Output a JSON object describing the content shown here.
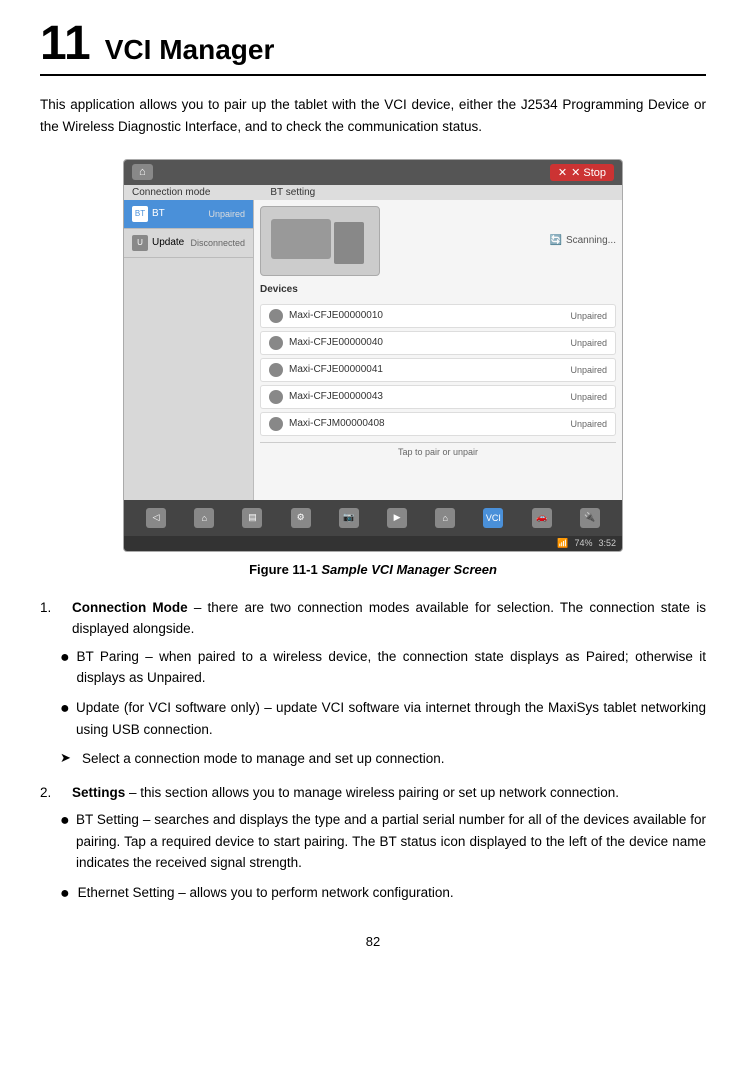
{
  "chapter": {
    "number": "11",
    "title": "VCI Manager"
  },
  "intro": {
    "paragraph": "This application allows you to pair up the tablet with the VCI device, either the J2534 Programming Device or the Wireless Diagnostic Interface, and to check the communication status."
  },
  "screenshot": {
    "top_bar": {
      "home_label": "⌂",
      "stop_label": "✕ Stop"
    },
    "mode_bar": {
      "left": "Connection mode",
      "right": "BT setting"
    },
    "left_panel": {
      "items": [
        {
          "icon": "BT",
          "label": "BT",
          "status": "Unpaired",
          "active": true
        },
        {
          "icon": "U",
          "label": "Update",
          "status": "Disconnected",
          "active": false
        }
      ]
    },
    "right_panel": {
      "device_labels": {
        "left": "Devices",
        "right": "Scanning..."
      },
      "devices": [
        {
          "name": "Maxi-CFJE00000010",
          "status": "Unpaired"
        },
        {
          "name": "Maxi-CFJE00000040",
          "status": "Unpaired"
        },
        {
          "name": "Maxi-CFJE00000041",
          "status": "Unpaired"
        },
        {
          "name": "Maxi-CFJE00000043",
          "status": "Unpaired"
        },
        {
          "name": "Maxi-CFJM00000408",
          "status": "Unpaired"
        }
      ],
      "tap_hint": "Tap to pair or unpair"
    },
    "status_bar": {
      "battery": "74%",
      "time": "3:52"
    }
  },
  "figure": {
    "label": "Figure 11-1",
    "italic_text": "Sample VCI Manager Screen"
  },
  "sections": [
    {
      "num": "1.",
      "term": "Connection Mode",
      "dash": "–",
      "text": " there are two connection modes available for selection. The connection state is displayed alongside.",
      "bullets": [
        {
          "type": "bullet",
          "text": "BT Paring – when paired to a wireless device, the connection state displays as Paired; otherwise it displays as Unpaired."
        },
        {
          "type": "bullet",
          "text": "Update (for VCI software only) – update VCI software via internet through the MaxiSys tablet networking using USB connection."
        }
      ],
      "arrows": [
        {
          "text": "Select a connection mode to manage and set up connection."
        }
      ]
    },
    {
      "num": "2.",
      "term": "Settings",
      "dash": "–",
      "text": " this section allows you to manage wireless pairing or set up network connection.",
      "bullets": [
        {
          "type": "bullet",
          "text": "BT Setting – searches and displays the type and a partial serial number for all of the devices available for pairing. Tap a required device to start pairing. The BT status icon displayed to the left of the device name indicates the received signal strength."
        },
        {
          "type": "bullet",
          "text": "Ethernet Setting – allows you to perform network configuration."
        }
      ],
      "arrows": []
    }
  ],
  "page_number": "82"
}
